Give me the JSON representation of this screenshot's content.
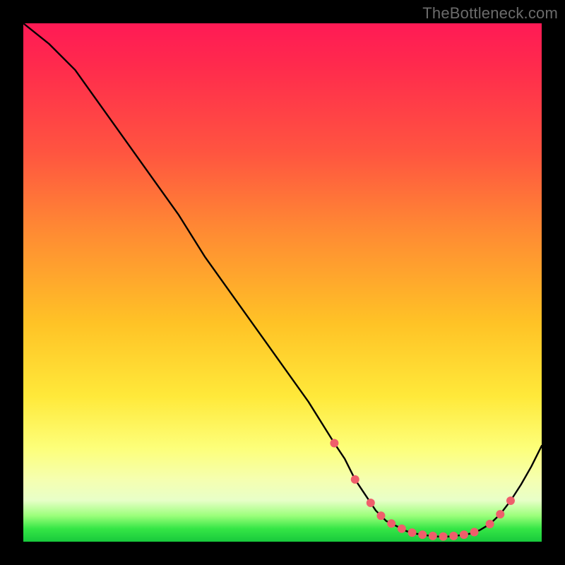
{
  "watermark": "TheBottleneck.com",
  "chart_data": {
    "type": "line",
    "title": "",
    "xlabel": "",
    "ylabel": "",
    "xlim": [
      0,
      100
    ],
    "ylim": [
      0,
      100
    ],
    "series": [
      {
        "name": "curve",
        "x": [
          0,
          5,
          10,
          15,
          20,
          25,
          30,
          35,
          40,
          45,
          50,
          55,
          60,
          62,
          64,
          66,
          68,
          70,
          72,
          74,
          76,
          78,
          80,
          82,
          84,
          86,
          88,
          90,
          92,
          94,
          96,
          98,
          100
        ],
        "y": [
          100,
          96,
          91,
          84,
          77,
          70,
          63,
          55,
          48,
          41,
          34,
          27,
          19,
          16,
          12,
          9,
          6,
          4,
          3,
          2,
          1.5,
          1.2,
          1.0,
          1.0,
          1.2,
          1.5,
          2.2,
          3.4,
          5.3,
          7.9,
          11.0,
          14.5,
          18.5
        ]
      }
    ],
    "markers": {
      "series": "curve",
      "color": "#ef5e6b",
      "radius_px": 6,
      "points_x": [
        60,
        64,
        67,
        69,
        71,
        73,
        75,
        77,
        79,
        81,
        83,
        85,
        87,
        90,
        92,
        94
      ]
    },
    "background_gradient": {
      "direction": "vertical",
      "stops": [
        {
          "pos": 0.0,
          "color": "#ff1a55"
        },
        {
          "pos": 0.25,
          "color": "#ff5540"
        },
        {
          "pos": 0.58,
          "color": "#ffc326"
        },
        {
          "pos": 0.82,
          "color": "#fdff7a"
        },
        {
          "pos": 0.95,
          "color": "#9bff7a"
        },
        {
          "pos": 1.0,
          "color": "#18c93c"
        }
      ]
    }
  }
}
